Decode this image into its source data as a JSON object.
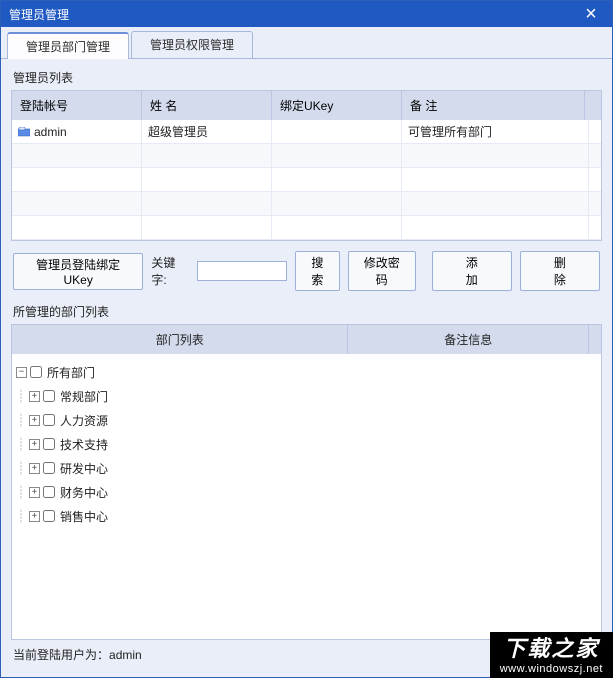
{
  "window": {
    "title": "管理员管理",
    "close_glyph": "×"
  },
  "tabs": {
    "dept": "管理员部门管理",
    "perm": "管理员权限管理"
  },
  "admin_list": {
    "label": "管理员列表",
    "headers": {
      "account": "登陆帐号",
      "name": "姓 名",
      "ukey": "绑定UKey",
      "remark": "备 注"
    },
    "rows": [
      {
        "account": "admin",
        "name": "超级管理员",
        "ukey": "",
        "remark": "可管理所有部门"
      }
    ]
  },
  "toolbar": {
    "bind_ukey": "管理员登陆绑定UKey",
    "keyword_label": "关键字:",
    "keyword_value": "",
    "search": "搜索",
    "change_pwd": "修改密码",
    "add": "添 加",
    "delete": "删 除"
  },
  "dept_tree": {
    "label": "所管理的部门列表",
    "headers": {
      "dept": "部门列表",
      "remark": "备注信息"
    },
    "root": {
      "label": "所有部门",
      "expander": "−"
    },
    "children": [
      {
        "label": "常规部门",
        "expander": "+"
      },
      {
        "label": "人力资源",
        "expander": "+"
      },
      {
        "label": "技术支持",
        "expander": "+"
      },
      {
        "label": "研发中心",
        "expander": "+"
      },
      {
        "label": "财务中心",
        "expander": "+"
      },
      {
        "label": "销售中心",
        "expander": "+"
      }
    ]
  },
  "status": {
    "prefix": "当前登陆用户为：",
    "user": "admin"
  },
  "watermark": {
    "top": "下载之家",
    "bottom": "www.windowszj.net"
  }
}
